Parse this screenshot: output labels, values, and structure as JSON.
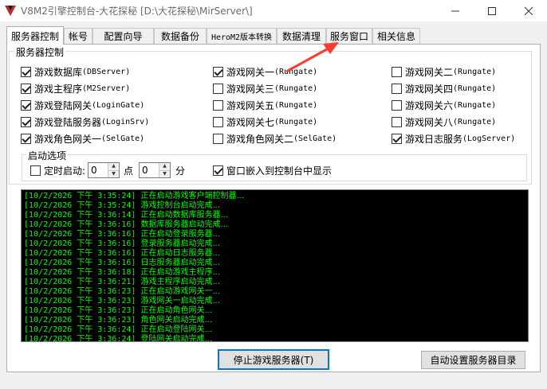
{
  "window": {
    "title": "V8M2引擎控制台-大花探秘 [D:\\大花探秘\\MirServer\\]"
  },
  "tabs": [
    {
      "label": "服务器控制",
      "active": true
    },
    {
      "label": "帐号",
      "active": false
    },
    {
      "label": "配置向导",
      "active": false
    },
    {
      "label": "数据备份",
      "active": false
    },
    {
      "label": "HeroM2版本转换",
      "active": false
    },
    {
      "label": "数据清理",
      "active": false
    },
    {
      "label": "服务窗口",
      "active": false
    },
    {
      "label": "相关信息",
      "active": false
    }
  ],
  "server_control": {
    "legend": "服务器控制",
    "col1": [
      {
        "name": "游戏数据库",
        "code": "(DBServer)",
        "checked": true
      },
      {
        "name": "游戏主程序",
        "code": "(M2Server)",
        "checked": true
      },
      {
        "name": "游戏登陆网关",
        "code": "(LoginGate)",
        "checked": true
      },
      {
        "name": "游戏登陆服务器",
        "code": "(LoginSrv)",
        "checked": true
      },
      {
        "name": "游戏角色网关一",
        "code": "(SelGate)",
        "checked": true
      }
    ],
    "col2": [
      {
        "name": "游戏网关一",
        "code": "(Rungate)",
        "checked": true
      },
      {
        "name": "游戏网关三",
        "code": "(Rungate)",
        "checked": false
      },
      {
        "name": "游戏网关五",
        "code": "(Rungate)",
        "checked": false
      },
      {
        "name": "游戏网关七",
        "code": "(Rungate)",
        "checked": false
      },
      {
        "name": "游戏角色网关二",
        "code": "(SelGate)",
        "checked": false
      }
    ],
    "col3": [
      {
        "name": "游戏网关二",
        "code": "(Rungate)",
        "checked": false
      },
      {
        "name": "游戏网关四",
        "code": "(Rungate)",
        "checked": false
      },
      {
        "name": "游戏网关六",
        "code": "(Rungate)",
        "checked": false
      },
      {
        "name": "游戏网关八",
        "code": "(Rungate)",
        "checked": false
      },
      {
        "name": "游戏日志服务",
        "code": "(LogServer)",
        "checked": true
      }
    ]
  },
  "startup": {
    "legend": "启动选项",
    "timer_label": "定时启动:",
    "timer_checked": false,
    "hour_value": "0",
    "hour_unit": "点",
    "minute_value": "0",
    "minute_unit": "分",
    "embed_label": "窗口嵌入到控制台中显示",
    "embed_checked": true
  },
  "log": [
    {
      "time": "[10/2/2026 下午 3:35:24]",
      "msg": "正在启动游戏客户端控制器..."
    },
    {
      "time": "[10/2/2026 下午 3:35:24]",
      "msg": "游戏控制台启动完成..."
    },
    {
      "time": "[10/2/2026 下午 3:36:14]",
      "msg": "正在启动数据库服务器..."
    },
    {
      "time": "[10/2/2026 下午 3:36:16]",
      "msg": "数据库服务器启动完成..."
    },
    {
      "time": "[10/2/2026 下午 3:36:16]",
      "msg": "正在启动登录服务器..."
    },
    {
      "time": "[10/2/2026 下午 3:36:16]",
      "msg": "登录服务器启动完成..."
    },
    {
      "time": "[10/2/2026 下午 3:36:16]",
      "msg": "正在启动日志服务器..."
    },
    {
      "time": "[10/2/2026 下午 3:36:16]",
      "msg": "日志服务器启动完成..."
    },
    {
      "time": "[10/2/2026 下午 3:36:18]",
      "msg": "正在启动游戏主程序..."
    },
    {
      "time": "[10/2/2026 下午 3:36:21]",
      "msg": "游戏主程序启动完成..."
    },
    {
      "time": "[10/2/2026 下午 3:36:23]",
      "msg": "正在启动游戏网关一..."
    },
    {
      "time": "[10/2/2026 下午 3:36:23]",
      "msg": "游戏网关一启动完成..."
    },
    {
      "time": "[10/2/2026 下午 3:36:23]",
      "msg": "正在启动角色网关..."
    },
    {
      "time": "[10/2/2026 下午 3:36:23]",
      "msg": "角色网关启动完成..."
    },
    {
      "time": "[10/2/2026 下午 3:36:24]",
      "msg": "正在启动登陆网关..."
    },
    {
      "time": "[10/2/2026 下午 3:36:24]",
      "msg": "登陆网关启动完成..."
    }
  ],
  "buttons": {
    "stop_label": "停止游戏服务器(T)",
    "autoset_label": "自动设置服务器目录"
  },
  "colors": {
    "log_text": "#00ff00",
    "log_bg": "#000000",
    "annotation_arrow": "#ff3b2f",
    "focus_border": "#0078d7"
  }
}
